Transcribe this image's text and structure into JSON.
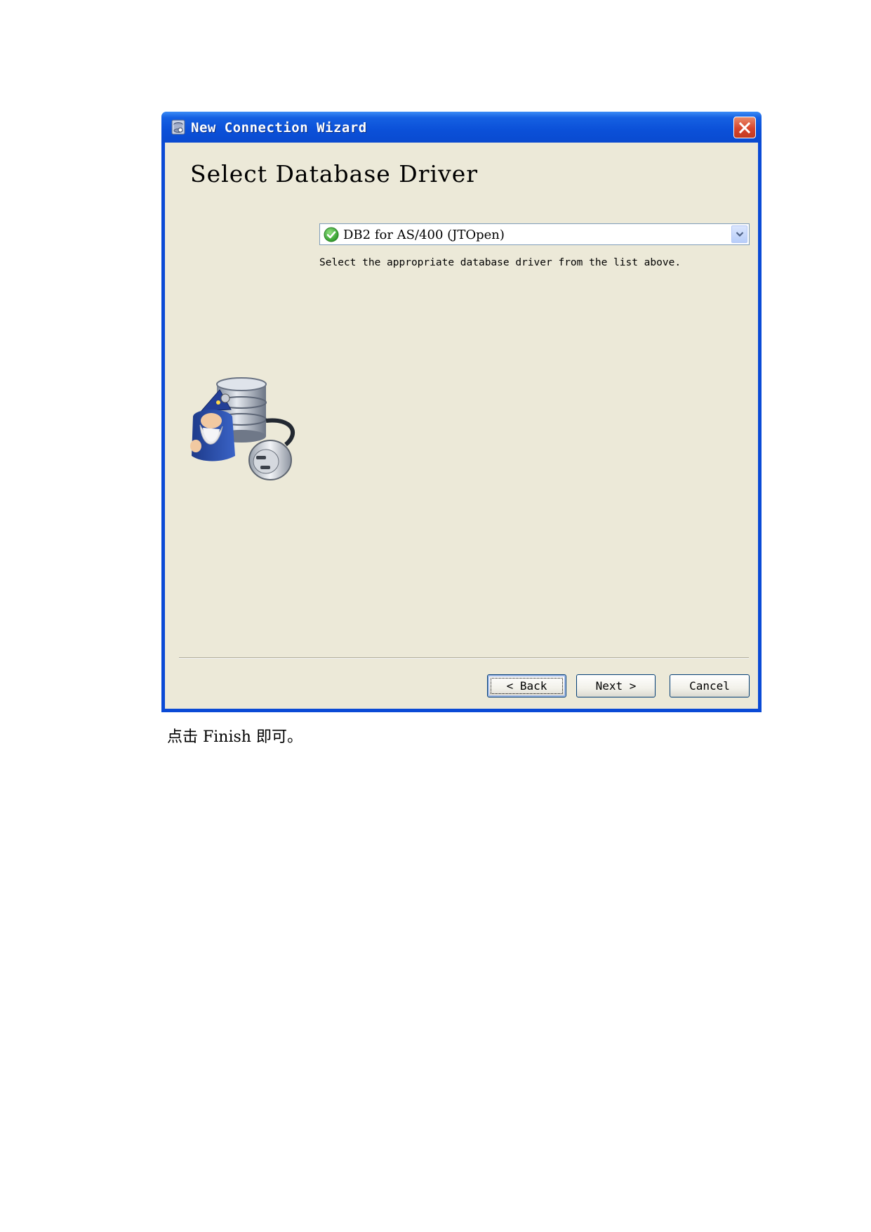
{
  "window": {
    "title": "New Connection Wizard",
    "heading": "Select Database Driver",
    "driver_select": {
      "selected_value": "DB2 for AS/400 (JTOpen)",
      "status_icon": "green-check-icon"
    },
    "hint": "Select the appropriate database driver from the list above.",
    "illustration": "wizard-database-plug",
    "buttons": {
      "back": "< Back",
      "next": "Next >",
      "cancel": "Cancel"
    }
  },
  "caption": "点击 Finish 即可。",
  "colors": {
    "titlebar": "#0a4ad6",
    "client_bg": "#ece9d8",
    "close_button": "#d8452c",
    "check_green": "#3fb63b"
  }
}
